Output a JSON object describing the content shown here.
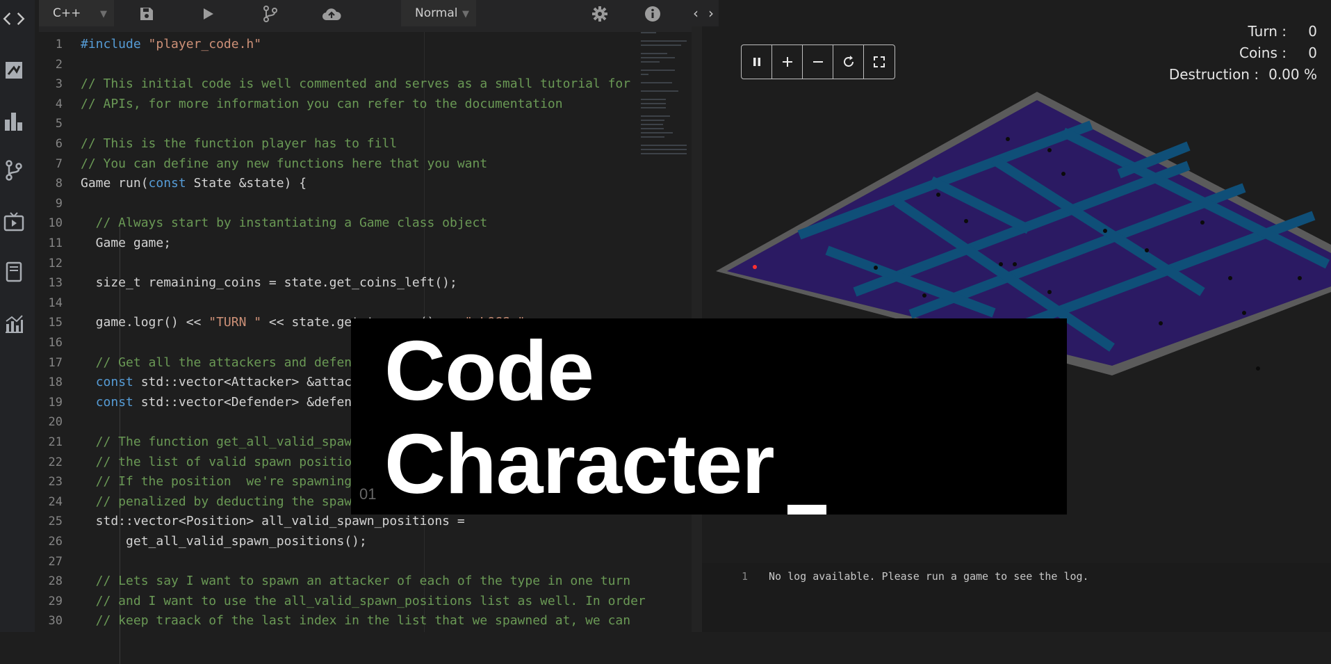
{
  "sidebar": {
    "icons": [
      "code-icon",
      "map-icon",
      "bar-chart-icon",
      "branch-icon",
      "tv-icon",
      "book-icon",
      "stats-icon"
    ]
  },
  "toolbar": {
    "language": "C++",
    "mode": "Normal",
    "icons": [
      "save-icon",
      "run-icon",
      "commit-icon",
      "upload-icon",
      "settings-icon",
      "info-icon"
    ]
  },
  "editor": {
    "lines": [
      {
        "n": "1",
        "segments": [
          {
            "t": "#include ",
            "c": "kw"
          },
          {
            "t": "\"player_code.h\"",
            "c": "st"
          }
        ]
      },
      {
        "n": "2",
        "segments": []
      },
      {
        "n": "3",
        "segments": [
          {
            "t": "// This initial code is well commented and serves as a small tutorial for",
            "c": "cm"
          }
        ]
      },
      {
        "n": "4",
        "segments": [
          {
            "t": "// APIs, for more information you can refer to the documentation",
            "c": "cm"
          }
        ]
      },
      {
        "n": "5",
        "segments": []
      },
      {
        "n": "6",
        "segments": [
          {
            "t": "// This is the function player has to fill",
            "c": "cm"
          }
        ]
      },
      {
        "n": "7",
        "segments": [
          {
            "t": "// You can define any new functions here that you want",
            "c": "cm"
          }
        ]
      },
      {
        "n": "8",
        "segments": [
          {
            "t": "Game run(",
            "c": ""
          },
          {
            "t": "const",
            "c": "kw"
          },
          {
            "t": " State &state) {",
            "c": ""
          }
        ]
      },
      {
        "n": "9",
        "segments": []
      },
      {
        "n": "10",
        "segments": [
          {
            "t": "  // Always start by instantiating a Game class object",
            "c": "cm"
          }
        ]
      },
      {
        "n": "11",
        "segments": [
          {
            "t": "  Game game;",
            "c": ""
          }
        ]
      },
      {
        "n": "12",
        "segments": []
      },
      {
        "n": "13",
        "segments": [
          {
            "t": "  size_t remaining_coins = state.get_coins_left();",
            "c": ""
          }
        ]
      },
      {
        "n": "14",
        "segments": []
      },
      {
        "n": "15",
        "segments": [
          {
            "t": "  game.logr() << ",
            "c": ""
          },
          {
            "t": "\"TURN \"",
            "c": "st"
          },
          {
            "t": " << state.get_turn_no() << ",
            "c": ""
          },
          {
            "t": "\" LOGS \"",
            "c": "st"
          },
          {
            "t": ";",
            "c": ""
          }
        ]
      },
      {
        "n": "16",
        "segments": []
      },
      {
        "n": "17",
        "segments": [
          {
            "t": "  // Get all the attackers and defenders",
            "c": "cm"
          }
        ]
      },
      {
        "n": "18",
        "segments": [
          {
            "t": "  ",
            "c": ""
          },
          {
            "t": "const",
            "c": "kw"
          },
          {
            "t": " std::vector<Attacker> &attackers",
            "c": ""
          }
        ]
      },
      {
        "n": "19",
        "segments": [
          {
            "t": "  ",
            "c": ""
          },
          {
            "t": "const",
            "c": "kw"
          },
          {
            "t": " std::vector<Defender> &defenders",
            "c": ""
          }
        ]
      },
      {
        "n": "20",
        "segments": []
      },
      {
        "n": "21",
        "segments": [
          {
            "t": "  // The function get_all_valid_spawn_positions",
            "c": "cm"
          }
        ]
      },
      {
        "n": "22",
        "segments": [
          {
            "t": "  // the list of valid spawn positions",
            "c": "cm"
          }
        ]
      },
      {
        "n": "23",
        "segments": [
          {
            "t": "  // If the position  we're spawning",
            "c": "cm"
          }
        ]
      },
      {
        "n": "24",
        "segments": [
          {
            "t": "  // penalized by deducting the spawn",
            "c": "cm"
          }
        ]
      },
      {
        "n": "25",
        "segments": [
          {
            "t": "  std::vector<Position> all_valid_spawn_positions =",
            "c": ""
          }
        ]
      },
      {
        "n": "26",
        "segments": [
          {
            "t": "      get_all_valid_spawn_positions();",
            "c": ""
          }
        ]
      },
      {
        "n": "27",
        "segments": []
      },
      {
        "n": "28",
        "segments": [
          {
            "t": "  // Lets say I want to spawn an attacker of each of the type in one turn",
            "c": "cm"
          }
        ]
      },
      {
        "n": "29",
        "segments": [
          {
            "t": "  // and I want to use the all_valid_spawn_positions list as well. In order",
            "c": "cm"
          }
        ]
      },
      {
        "n": "30",
        "segments": [
          {
            "t": "  // keep traack of the last index in the list that we spawned at, we can",
            "c": "cm"
          }
        ]
      }
    ]
  },
  "game": {
    "controls": [
      "pause-icon",
      "zoom-in-icon",
      "zoom-out-icon",
      "restart-icon",
      "fullscreen-icon"
    ],
    "stats": [
      {
        "label": "Turn :",
        "value": "0"
      },
      {
        "label": "Coins :",
        "value": "0"
      },
      {
        "label": "Destruction :",
        "value": "0.00 %"
      }
    ]
  },
  "log": {
    "line_no": "1",
    "text": "No log available. Please run a game to see the log."
  },
  "banner": {
    "line1": "Code",
    "line2": "Character",
    "cursor": "_",
    "index": "01"
  },
  "colors": {
    "map_floor": "#2b1a63",
    "map_path": "#0f4f78",
    "map_wall": "#5a5a5a",
    "comment": "#6a9955",
    "keyword": "#569cd6",
    "string": "#ce9178"
  }
}
